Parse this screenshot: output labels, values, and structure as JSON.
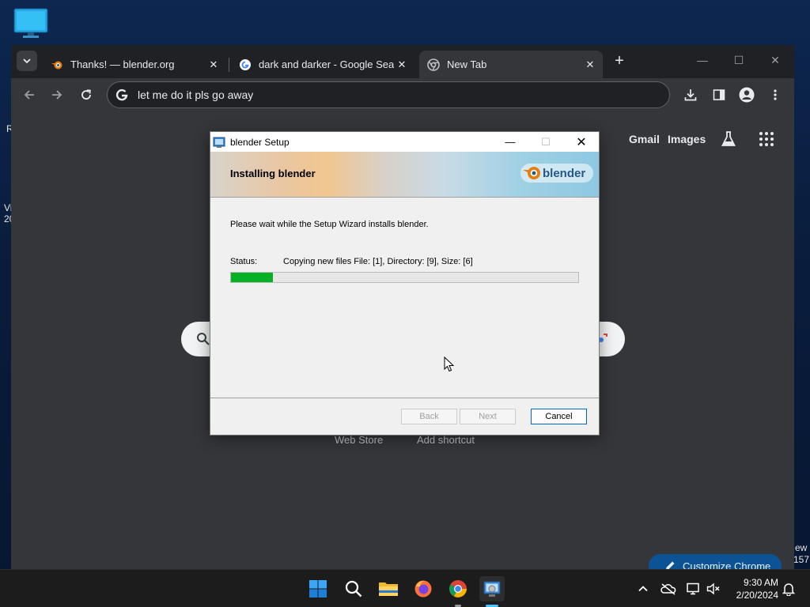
{
  "desktop": {
    "edge_left_1": "R",
    "edge_left_2": "Vi",
    "edge_left_3": "20",
    "edge_right_1": "ew",
    "edge_right_2": "157"
  },
  "browser": {
    "tabs": [
      {
        "title": "Thanks! — blender.org",
        "icon": "blender-icon"
      },
      {
        "title": "dark and darker - Google Search",
        "icon": "google-icon"
      },
      {
        "title": "New Tab",
        "icon": "chrome-icon"
      }
    ],
    "address": "let me do it pls go away",
    "links": {
      "gmail": "Gmail",
      "images": "Images"
    },
    "shortcuts": {
      "web_store": "Web Store",
      "add_shortcut": "Add shortcut"
    },
    "customize": "Customize Chrome"
  },
  "dialog": {
    "title": "blender Setup",
    "heading": "Installing blender",
    "logo_text": "blender",
    "body": "Please wait while the Setup Wizard installs blender.",
    "status_label": "Status:",
    "status_value": "Copying new files File: [1],  Directory: [9],  Size: [6]",
    "progress_fraction": 0.12,
    "buttons": {
      "back": "Back",
      "next": "Next",
      "cancel": "Cancel"
    }
  },
  "taskbar": {
    "time": "9:30 AM",
    "date": "2/20/2024"
  },
  "colors": {
    "progress": "#06b025",
    "chrome_bg": "#35363a",
    "accent": "#0067c0"
  }
}
